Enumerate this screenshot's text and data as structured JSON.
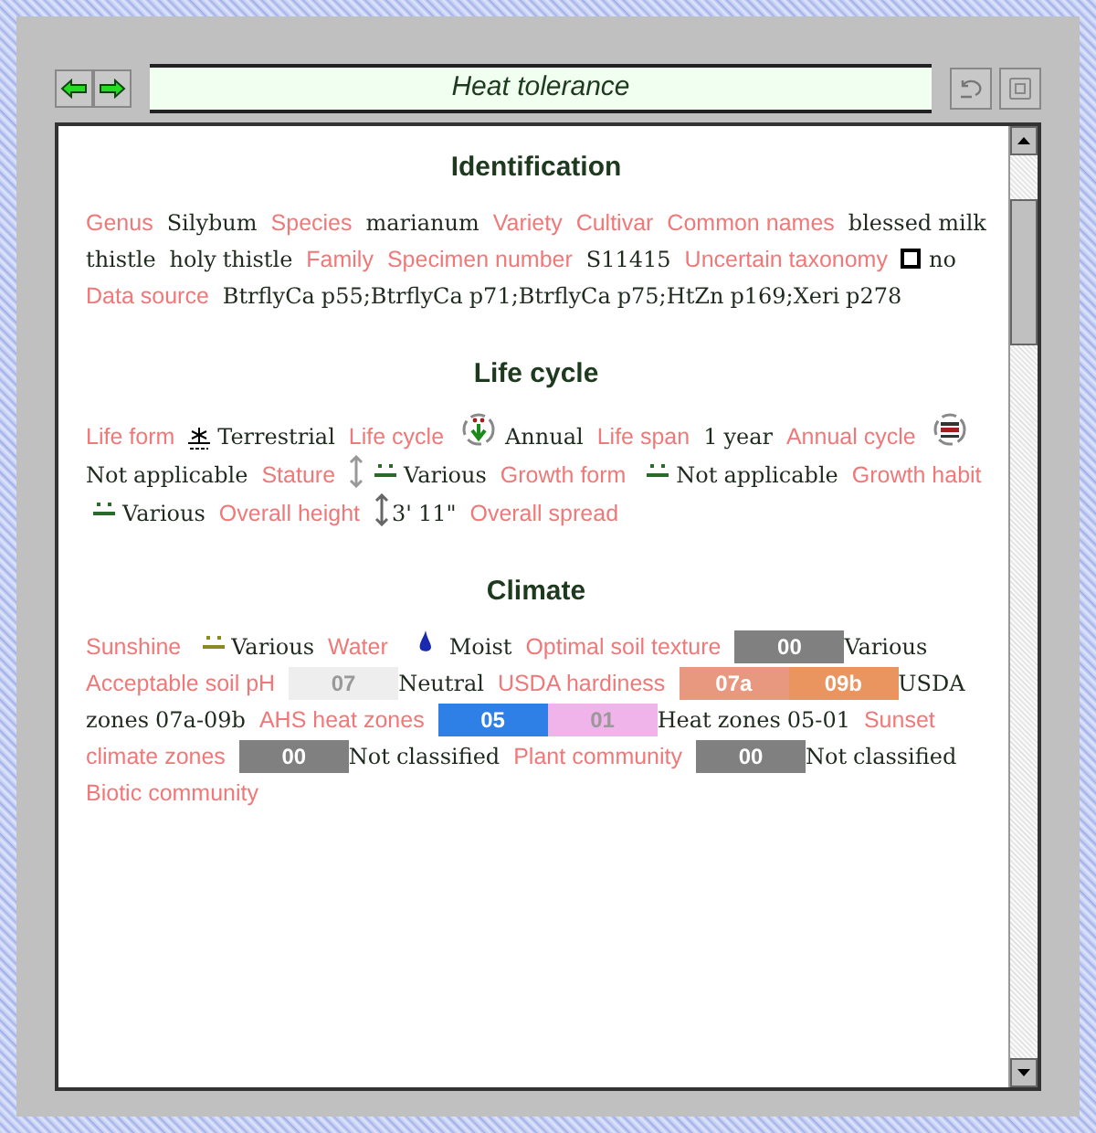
{
  "toolbar": {
    "title": "Heat tolerance"
  },
  "sections": [
    {
      "title": "Identification",
      "fields": [
        {
          "label": "Genus",
          "parts": [
            {
              "kind": "text",
              "text": "Silybum"
            }
          ]
        },
        {
          "label": "Species",
          "parts": [
            {
              "kind": "text",
              "text": "marianum"
            }
          ]
        },
        {
          "label": "Variety"
        },
        {
          "label": "Cultivar"
        },
        {
          "label": "Common names",
          "parts": [
            {
              "kind": "text",
              "text": "blessed milk thistle"
            },
            {
              "kind": "text",
              "text": "holy thistle"
            }
          ]
        },
        {
          "label": "Family"
        },
        {
          "label": "Specimen number",
          "parts": [
            {
              "kind": "text",
              "text": "S11415"
            }
          ]
        },
        {
          "label": "Uncertain taxonomy",
          "parts": [
            {
              "kind": "checkbox",
              "checked": false
            },
            {
              "kind": "text",
              "text": "no"
            }
          ]
        },
        {
          "label": "Data source",
          "parts": [
            {
              "kind": "text",
              "text": "BtrflyCa p55;BtrflyCa p71;BtrflyCa p75;HtZn p169;Xeri p278"
            }
          ]
        }
      ]
    },
    {
      "title": "Life cycle",
      "fields": [
        {
          "label": "Life form",
          "parts": [
            {
              "kind": "terrestrial"
            },
            {
              "kind": "text",
              "text": "Terrestrial"
            }
          ]
        },
        {
          "label": "Life cycle",
          "parts": [
            {
              "kind": "annual"
            },
            {
              "kind": "text",
              "text": "Annual"
            }
          ]
        },
        {
          "label": "Life span",
          "parts": [
            {
              "kind": "text",
              "text": "1 year"
            }
          ]
        },
        {
          "label": "Annual cycle",
          "parts": [
            {
              "kind": "cycle"
            },
            {
              "kind": "text",
              "text": "Not applicable"
            }
          ]
        },
        {
          "label": "Stature",
          "parts": [
            {
              "kind": "height"
            },
            {
              "kind": "various"
            },
            {
              "kind": "text",
              "text": "Various"
            }
          ]
        },
        {
          "label": "Growth form",
          "parts": [
            {
              "kind": "various"
            },
            {
              "kind": "text",
              "text": "Not applicable"
            }
          ]
        },
        {
          "label": "Growth habit",
          "parts": [
            {
              "kind": "various"
            },
            {
              "kind": "text",
              "text": "Various"
            }
          ]
        },
        {
          "label": "Overall height",
          "parts": [
            {
              "kind": "height-dark"
            },
            {
              "kind": "text",
              "text": "3' 11\""
            }
          ]
        },
        {
          "label": "Overall spread"
        }
      ]
    },
    {
      "title": "Climate",
      "fields": [
        {
          "label": "Sunshine",
          "parts": [
            {
              "kind": "various-sun"
            },
            {
              "kind": "text",
              "text": "Various"
            }
          ]
        },
        {
          "label": "Water",
          "parts": [
            {
              "kind": "drop"
            },
            {
              "kind": "text",
              "text": "Moist"
            }
          ]
        },
        {
          "label": "Optimal soil texture",
          "parts": [
            {
              "kind": "swatch",
              "text": "00",
              "color": "#808080"
            },
            {
              "kind": "text",
              "text": "Various"
            }
          ]
        },
        {
          "label": "Acceptable soil pH",
          "parts": [
            {
              "kind": "swatch",
              "text": "07",
              "color": "#eeeeee"
            },
            {
              "kind": "text",
              "text": "Neutral"
            }
          ]
        },
        {
          "label": "USDA hardiness",
          "parts": [
            {
              "kind": "swatch",
              "text": "07a",
              "color": "#e8987e"
            },
            {
              "kind": "swatch",
              "text": "09b",
              "color": "#ea9460"
            },
            {
              "kind": "text",
              "text": "USDA zones 07a-09b"
            }
          ]
        },
        {
          "label": "AHS heat zones",
          "parts": [
            {
              "kind": "swatch",
              "text": "05",
              "color": "#2f80e6"
            },
            {
              "kind": "swatch",
              "text": "01",
              "color": "#f0b4ea"
            },
            {
              "kind": "text",
              "text": "Heat zones 05-01"
            }
          ]
        },
        {
          "label": "Sunset climate zones",
          "parts": [
            {
              "kind": "swatch",
              "text": "00",
              "color": "#808080"
            },
            {
              "kind": "text",
              "text": "Not classified"
            }
          ]
        },
        {
          "label": "Plant community",
          "parts": [
            {
              "kind": "swatch",
              "text": "00",
              "color": "#808080"
            },
            {
              "kind": "text",
              "text": "Not classified"
            }
          ]
        },
        {
          "label": "Biotic community"
        }
      ]
    }
  ]
}
